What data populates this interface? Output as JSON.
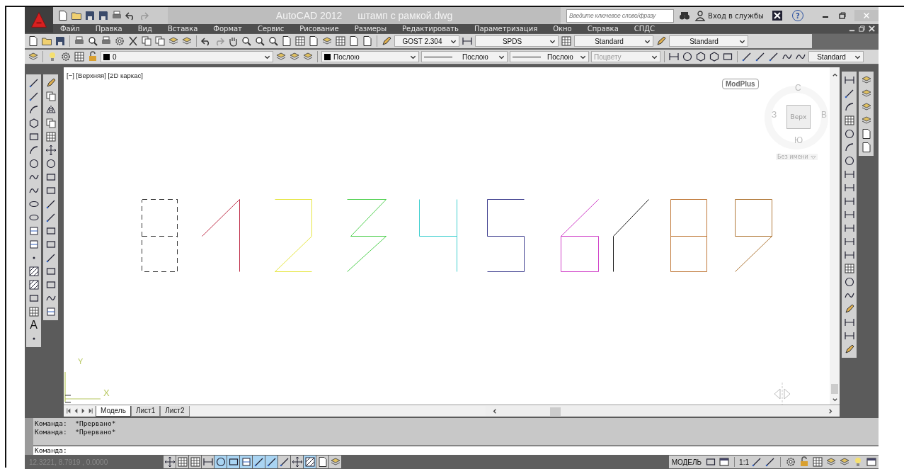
{
  "title_bar": {
    "app": "AutoCAD 2012",
    "file": "штамп с рамкой.dwg"
  },
  "search": {
    "placeholder": "Введите ключевое слово/фразу"
  },
  "signin": "Вход в службы",
  "help": "?",
  "menu": [
    "Файл",
    "Правка",
    "Вид",
    "Вставка",
    "Формат",
    "Сервис",
    "Рисование",
    "Размеры",
    "Редактировать",
    "Параметризация",
    "Окно",
    "Справка",
    "СПДС"
  ],
  "styles_toolbar": {
    "text_style": "GOST 2.304",
    "dim_style": "SPDS",
    "table_style": "Standard",
    "mleader_style": "Standard"
  },
  "properties_toolbar": {
    "layer": "0",
    "color_setting": "Послою",
    "linetype": "Послою",
    "lineweight": "Послою",
    "plot_style": {
      "value": "Поцвету",
      "disabled": true
    },
    "mleader_style": "Standard"
  },
  "draw_toolbar": {
    "mtext_button": "A"
  },
  "viewport": {
    "label": "[−] [Верхняя] [2D каркас]",
    "modplus": "ModPlus"
  },
  "viewcube": {
    "north": "С",
    "west": "З",
    "east": "В",
    "south": "Ю",
    "face": "Верх",
    "ucs": "Без имени"
  },
  "ucs_icon": {
    "y": "Y",
    "x": "X"
  },
  "drawing": {
    "entities": [
      {
        "kind": "template",
        "color": "#333333"
      },
      {
        "kind": "digit",
        "color": "#c0304a"
      },
      {
        "kind": "digit",
        "color": "#e6e640"
      },
      {
        "kind": "digit",
        "color": "#50d050"
      },
      {
        "kind": "digit",
        "color": "#40d0d0"
      },
      {
        "kind": "digit",
        "color": "#404090"
      },
      {
        "kind": "digit",
        "color": "#d040c8"
      },
      {
        "kind": "digit",
        "color": "#202020"
      },
      {
        "kind": "digit",
        "color": "#c07838"
      },
      {
        "kind": "digit",
        "color": "#b07838"
      }
    ]
  },
  "tabs": [
    {
      "label": "Модель",
      "selected": true
    },
    {
      "label": "Лист1",
      "selected": false
    },
    {
      "label": "Лист2",
      "selected": false
    }
  ],
  "command": {
    "history": [
      "Команда:  *Прервано*",
      "Команда:  *Прервано*"
    ],
    "prompt": "Команда:"
  },
  "status_bar": {
    "coordinates": "12.3221, 8.7919 , 0.0000",
    "toggles": [
      {
        "on": false
      },
      {
        "on": false
      },
      {
        "on": false
      },
      {
        "on": false
      },
      {
        "on": true
      },
      {
        "on": true
      },
      {
        "on": true
      },
      {
        "on": true
      },
      {
        "on": true
      },
      {
        "on": false
      },
      {
        "on": false
      },
      {
        "on": true
      },
      {
        "on": false
      },
      {
        "on": false
      }
    ],
    "model": "МОДЕЛЬ",
    "scale": "1:1"
  }
}
